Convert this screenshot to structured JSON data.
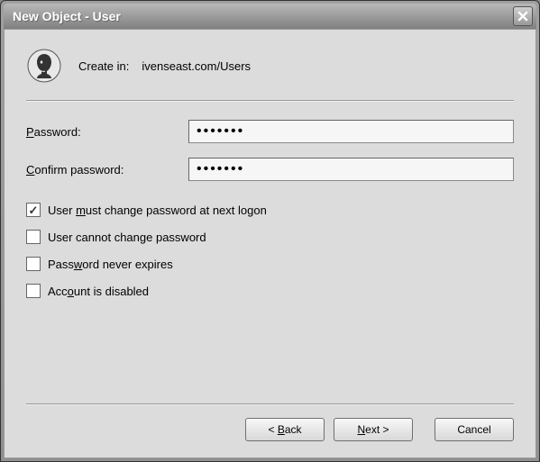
{
  "window": {
    "title": "New Object - User"
  },
  "header": {
    "create_in_label": "Create in:",
    "create_in_path": "ivenseast.com/Users"
  },
  "fields": {
    "password_label": "Password:",
    "password_value": "•••••••",
    "confirm_label": "Confirm password:",
    "confirm_value": "•••••••"
  },
  "checkboxes": {
    "must_change": {
      "label_pre": "User ",
      "label_u": "m",
      "label_post": "ust change password at next logon",
      "checked": true
    },
    "cannot_change": {
      "label": "User cannot change password",
      "checked": false
    },
    "never_expires": {
      "label_pre": "Pass",
      "label_u": "w",
      "label_post": "ord never expires",
      "checked": false
    },
    "disabled": {
      "label_pre": "Acc",
      "label_u": "o",
      "label_post": "unt is disabled",
      "checked": false
    }
  },
  "buttons": {
    "back_pre": "< ",
    "back_u": "B",
    "back_post": "ack",
    "next_u": "N",
    "next_post": "ext >",
    "cancel": "Cancel"
  }
}
